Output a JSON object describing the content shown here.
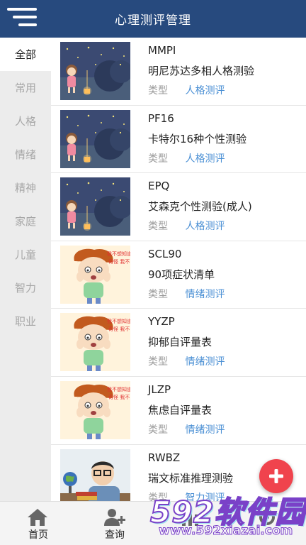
{
  "header": {
    "title": "心理测评管理"
  },
  "sidebar": {
    "items": [
      {
        "label": "全部",
        "active": true
      },
      {
        "label": "常用",
        "active": false
      },
      {
        "label": "人格",
        "active": false
      },
      {
        "label": "情绪",
        "active": false
      },
      {
        "label": "精神",
        "active": false
      },
      {
        "label": "家庭",
        "active": false
      },
      {
        "label": "儿童",
        "active": false
      },
      {
        "label": "智力",
        "active": false
      },
      {
        "label": "职业",
        "active": false
      }
    ]
  },
  "tests": [
    {
      "code": "MMPI",
      "name": "明尼苏达多相人格测验",
      "type_label": "类型",
      "type": "人格测评",
      "thumb": "night-girl-lantern"
    },
    {
      "code": "PF16",
      "name": "卡特尔16种个性测验",
      "type_label": "类型",
      "type": "人格测评",
      "thumb": "night-girl-lantern"
    },
    {
      "code": "EPQ",
      "name": "艾森克个性测验(成人)",
      "type_label": "类型",
      "type": "人格测评",
      "thumb": "night-girl-lantern"
    },
    {
      "code": "SCL90",
      "name": "90项症状清单",
      "type_label": "类型",
      "type": "情绪测评",
      "thumb": "worried-boy-cartoon"
    },
    {
      "code": "YYZP",
      "name": "抑郁自评量表",
      "type_label": "类型",
      "type": "情绪测评",
      "thumb": "worried-boy-cartoon"
    },
    {
      "code": "JLZP",
      "name": "焦虑自评量表",
      "type_label": "类型",
      "type": "情绪测评",
      "thumb": "worried-boy-cartoon"
    },
    {
      "code": "RWBZ",
      "name": "瑞文标准推理测验",
      "type_label": "类型",
      "type": "智力测评",
      "thumb": "boy-globe-glasses"
    }
  ],
  "cartoon_text": "我不想知道 奇怪 我不",
  "bottom_nav": [
    {
      "label": "首页",
      "icon": "home-icon"
    },
    {
      "label": "查询",
      "icon": "add-user-icon"
    },
    {
      "label": "",
      "icon": "chart-icon"
    },
    {
      "label": "",
      "icon": "settings-icon"
    }
  ],
  "watermark": {
    "brand": "592软件园",
    "url": "www.592xiazai.com"
  },
  "colors": {
    "header": "#274a7e",
    "sidebar": "#ececec",
    "type_value": "#4a8fd4",
    "fab": "#f0434d"
  }
}
